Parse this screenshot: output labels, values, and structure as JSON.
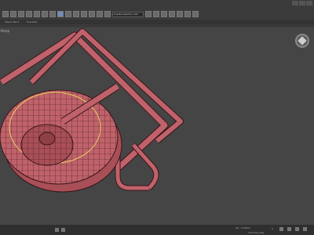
{
  "menu": [
    "Edit",
    "Modifiers",
    "Animation",
    "Graph Editors",
    "Rendering",
    "Civil View",
    "Customize",
    "Scripting",
    "Content",
    "Arnold",
    "Help",
    "MAXSCRIPT"
  ],
  "window": {
    "signin": "Sign In"
  },
  "toolbar": {
    "selection_set": "Create Selection Set"
  },
  "ribbon": [
    "Object Paint",
    "Populate"
  ],
  "viewport": {
    "label": "Persp"
  },
  "status": {
    "add_time_tag": "Add Time Tag",
    "frame_readout": "0/1 / 0.00km",
    "counter": "0"
  },
  "colors": {
    "mesh_fill": "#c0626b",
    "mesh_wire": "#3a1518",
    "selected_edge": "#e8d060",
    "viewport_bg": "#454545"
  }
}
